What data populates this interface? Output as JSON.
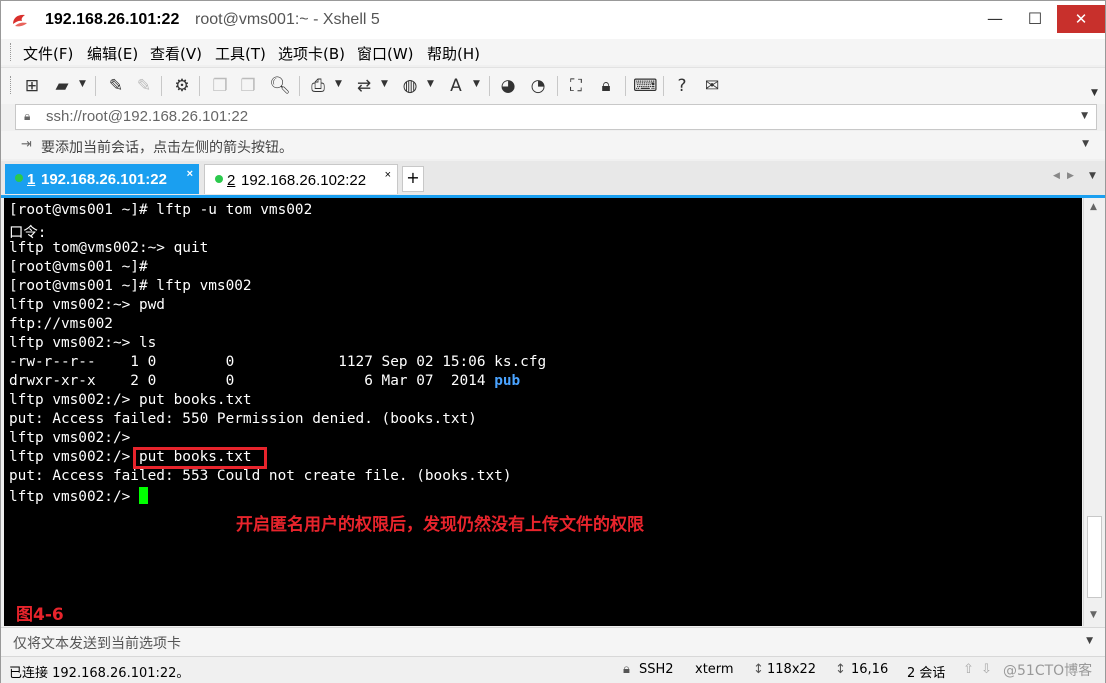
{
  "window": {
    "title_host": "192.168.26.101:22",
    "title_rest": "root@vms001:~ - Xshell 5",
    "min_glyph": "—",
    "max_glyph": "☐",
    "close_glyph": "✕"
  },
  "menu": [
    "文件(F)",
    "编辑(E)",
    "查看(V)",
    "工具(T)",
    "选项卡(B)",
    "窗口(W)",
    "帮助(H)"
  ],
  "address": {
    "text": "ssh://root@192.168.26.101:22"
  },
  "hint": {
    "text": "要添加当前会话，点击左侧的箭头按钮。"
  },
  "tabs": [
    {
      "num": "1",
      "host": "192.168.26.101:22",
      "close": "×"
    },
    {
      "num": "2",
      "host": "192.168.26.102:22",
      "close": "×"
    }
  ],
  "tab_add": "+",
  "terminal": {
    "lines": [
      "[root@vms001 ~]# lftp -u tom vms002",
      "口令:",
      "lftp tom@vms002:~> quit",
      "[root@vms001 ~]#",
      "[root@vms001 ~]# lftp vms002",
      "lftp vms002:~> pwd",
      "ftp://vms002",
      "lftp vms002:~> ls",
      "-rw-r--r--    1 0        0            1127 Sep 02 15:06 ks.cfg",
      "drwxr-xr-x    2 0        0               6 Mar 07  2014 ",
      "lftp vms002:/> put books.txt",
      "put: Access failed: 550 Permission denied. (books.txt)",
      "lftp vms002:/>",
      "lftp vms002:/> put books.txt",
      "put: Access failed: 553 Could not create file. (books.txt)",
      "lftp vms002:/> "
    ],
    "dir_name": "pub",
    "annotation": "开启匿名用户的权限后，发现仍然没有上传文件的权限",
    "figure_label": "图4-6"
  },
  "send_bar": {
    "text": "仅将文本发送到当前选项卡"
  },
  "status": {
    "connection": "已连接 192.168.26.101:22。",
    "protocol": "SSH2",
    "term": "xterm",
    "size": "118x22",
    "position": "16,16",
    "sessions": "2 会话",
    "watermark": "@51CTO博客"
  },
  "colors": {
    "accent": "#1a9ff0",
    "close": "#c8302c",
    "annotation": "#e8242c",
    "cursor": "#00ff00"
  }
}
